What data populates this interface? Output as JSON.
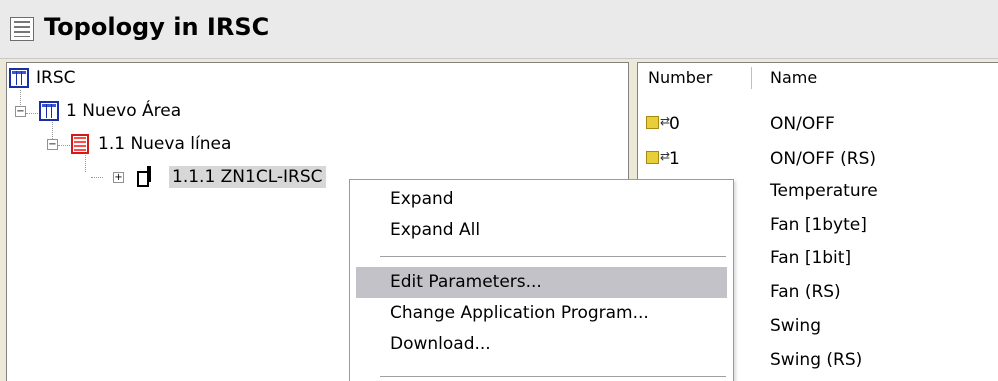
{
  "window": {
    "title": "Topology in IRSC"
  },
  "tree": {
    "root": {
      "label": "IRSC"
    },
    "area": {
      "label": "1 Nuevo Área",
      "expander": "−"
    },
    "line": {
      "label": "1.1 Nueva línea",
      "expander": "−"
    },
    "device": {
      "label": "1.1.1 ZN1CL-IRSC",
      "expander": "+"
    }
  },
  "list": {
    "columns": {
      "number": "Number",
      "name": "Name"
    },
    "rows": [
      {
        "number": "0",
        "name": "ON/OFF",
        "icon": "group-object-icon"
      },
      {
        "number": "1",
        "name": "ON/OFF (RS)",
        "icon": "group-object-icon"
      },
      {
        "number": "",
        "name": "Temperature"
      },
      {
        "number": "",
        "name": "Fan [1byte]"
      },
      {
        "number": "",
        "name": "Fan [1bit]"
      },
      {
        "number": "",
        "name": "Fan (RS)"
      },
      {
        "number": "",
        "name": "Swing"
      },
      {
        "number": "",
        "name": "Swing (RS)"
      }
    ]
  },
  "context_menu": {
    "items": [
      {
        "label": "Expand"
      },
      {
        "label": "Expand All"
      },
      {
        "label": "Edit Parameters...",
        "highlighted": true
      },
      {
        "label": "Change Application Program..."
      },
      {
        "label": "Download..."
      }
    ]
  },
  "colors": {
    "menu_highlight": "#c3c2c8",
    "selection": "#d7d7d7",
    "area_icon": "#1a2ea8",
    "line_icon": "#d21a1a"
  }
}
